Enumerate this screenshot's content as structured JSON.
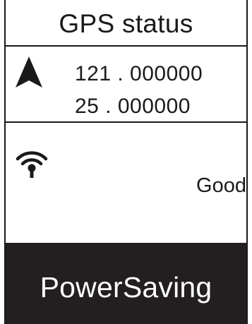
{
  "header": {
    "title": "GPS status"
  },
  "position": {
    "icon": "navigation-arrow-icon",
    "longitude": "121 . 000000",
    "latitude": "25 . 000000"
  },
  "signal": {
    "icon": "gps-signal-icon",
    "status": "Good"
  },
  "mode": {
    "label": "PowerSaving",
    "background_color": "#231f20",
    "text_color": "#ffffff"
  }
}
